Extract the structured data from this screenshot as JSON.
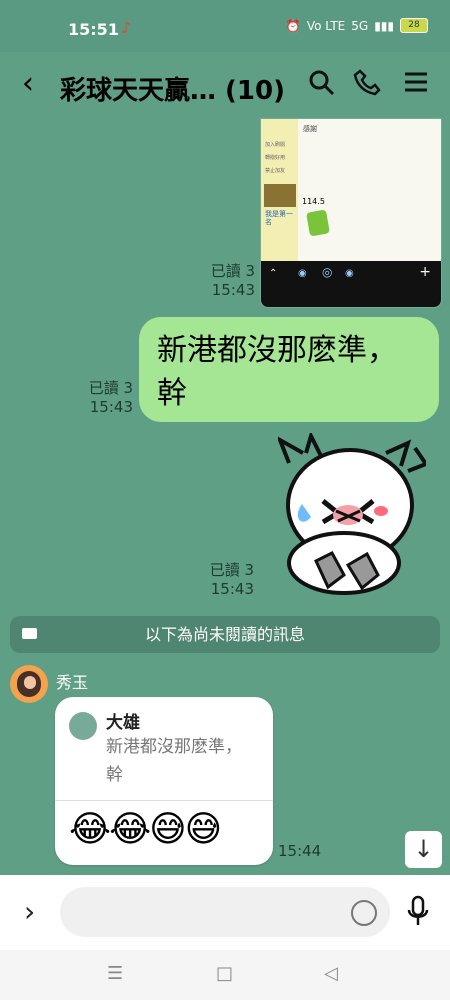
{
  "status": {
    "time": "15:51",
    "music_icon": "music-note-icon",
    "volte": "Vo LTE",
    "signal": "5G",
    "battery": "28"
  },
  "header": {
    "title": "彩球天天贏… (10)",
    "back_icon": "back-icon",
    "search_icon": "search-icon",
    "call_icon": "phone-icon",
    "menu_icon": "menu-icon"
  },
  "messages": [
    {
      "type": "image",
      "read": "已讀 3",
      "time": "15:43",
      "preview_text": [
        "感謝",
        "加入刷閱",
        "轉撥好用",
        "禁止加友",
        "我是第一名",
        "114.5"
      ]
    },
    {
      "type": "text",
      "read": "已讀 3",
      "time": "15:43",
      "text": "新港都沒那麽準，幹"
    },
    {
      "type": "sticker",
      "read": "已讀 3",
      "time": "15:43"
    }
  ],
  "unread_divider": "以下為尚未閱讀的訊息",
  "reply": {
    "sender": "秀玉",
    "quoted_name": "大雄",
    "quoted_text": "新港都沒那麽準，幹",
    "emojis": "😂😂😅😅",
    "time": "15:44"
  },
  "composer": {
    "placeholder": "",
    "expand_icon": "chevron-right-icon",
    "emoji_icon": "smile-icon",
    "mic_icon": "microphone-icon"
  },
  "navigation": {
    "menu": "☰",
    "home": "□",
    "back": "◁"
  },
  "colors": {
    "chat_bg": "#5f9f86",
    "my_bubble": "#a4e694",
    "accent": "#4f8672"
  }
}
